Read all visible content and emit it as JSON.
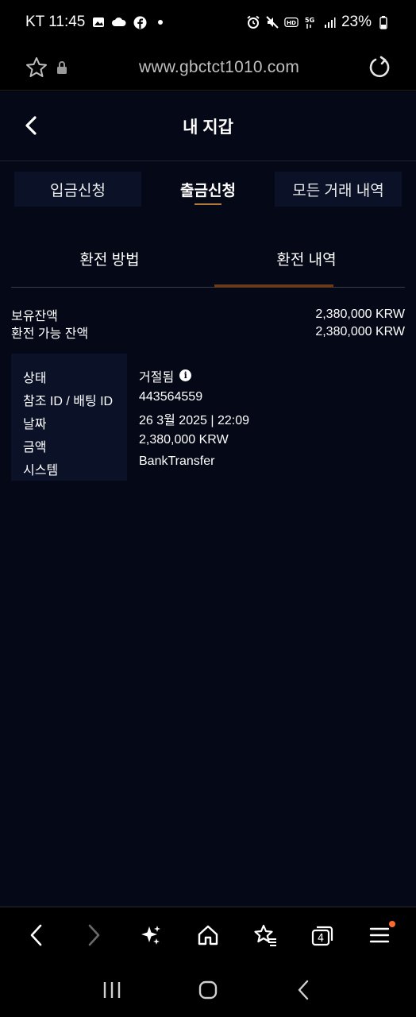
{
  "status_bar": {
    "carrier_time": "KT 11:45",
    "battery": "23%",
    "network": "5G"
  },
  "browser": {
    "url": "www.gbctct1010.com"
  },
  "header": {
    "title": "내 지갑"
  },
  "tabs": [
    {
      "label": "입금신청",
      "active": false
    },
    {
      "label": "출금신청",
      "active": true
    },
    {
      "label": "모든 거래 내역",
      "active": false
    }
  ],
  "subtabs": [
    {
      "label": "환전 방법",
      "active": false
    },
    {
      "label": "환전 내역",
      "active": true
    }
  ],
  "balance": {
    "held_label": "보유잔액",
    "held_value": "2,380,000 KRW",
    "available_label": "환전 가능 잔액",
    "available_value": "2,380,000 KRW"
  },
  "detail": {
    "status_label": "상태",
    "status_value": "거절됨",
    "ref_label": "참조 ID / 배팅 ID",
    "ref_value": "443564559",
    "date_label": "날짜",
    "date_value": "26 3월 2025 | 22:09",
    "amount_label": "금액",
    "amount_value": "2,380,000 KRW",
    "system_label": "시스템",
    "system_value": "BankTransfer"
  },
  "toolbar": {
    "tab_count": "4"
  },
  "colors": {
    "app_bg": "#050816",
    "tab_bg": "#0b1228",
    "accent": "#b07a3a",
    "notif": "#ff6b2c"
  }
}
